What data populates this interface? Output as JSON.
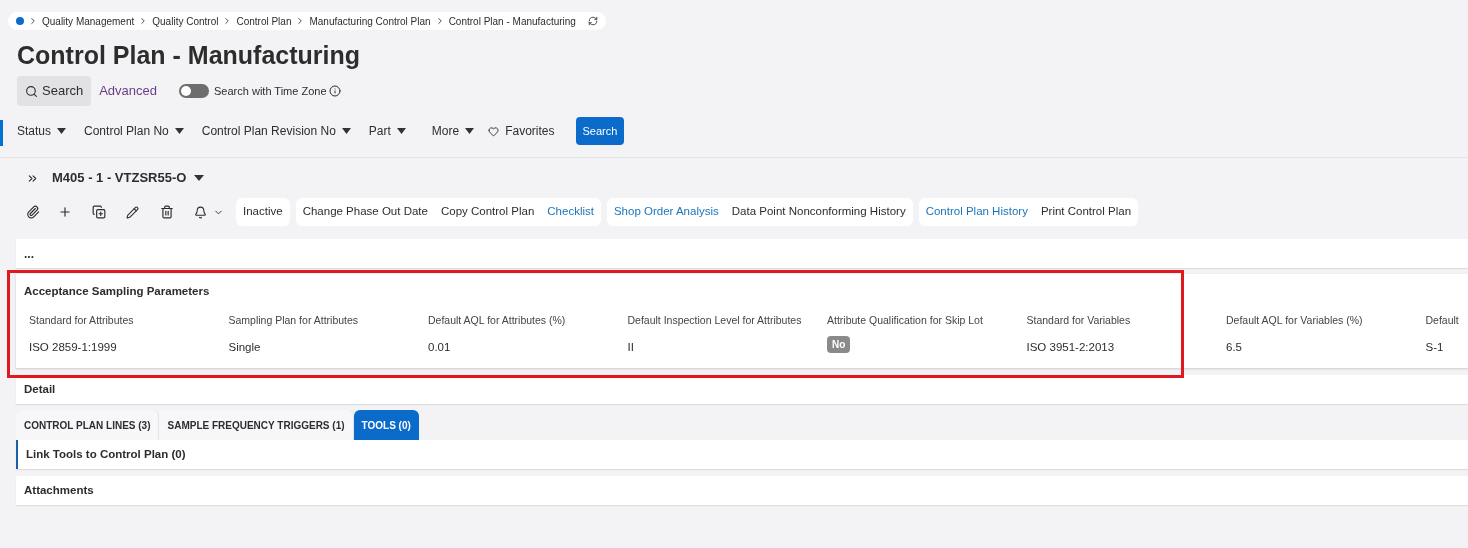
{
  "breadcrumb": [
    "Quality Management",
    "Quality Control",
    "Control Plan",
    "Manufacturing Control Plan",
    "Control Plan - Manufacturing"
  ],
  "title": "Control Plan - Manufacturing",
  "search_bar": {
    "search_tab": "Search",
    "advanced_tab": "Advanced",
    "time_zone_toggle": {
      "label": "Search with Time Zone",
      "on": false
    }
  },
  "filters": [
    "Status",
    "Control Plan No",
    "Control Plan Revision No",
    "Part",
    "More"
  ],
  "favorites": "Favorites",
  "search_button": "Search",
  "record": {
    "title": "M405 - 1 - VTZSR55-O"
  },
  "action_groups": [
    [
      {
        "label": "Inactive",
        "kind": "command"
      }
    ],
    [
      {
        "label": "Change Phase Out Date",
        "kind": "command"
      },
      {
        "label": "Copy Control Plan",
        "kind": "command"
      },
      {
        "label": "Checklist",
        "kind": "link"
      }
    ],
    [
      {
        "label": "Shop Order Analysis",
        "kind": "link"
      },
      {
        "label": "Data Point Nonconforming History",
        "kind": "command"
      }
    ],
    [
      {
        "label": "Control Plan History",
        "kind": "link"
      },
      {
        "label": "Print Control Plan",
        "kind": "command"
      }
    ]
  ],
  "collapsed_panel": "...",
  "sampling_section": {
    "title": "Acceptance Sampling Parameters",
    "highlighted": true,
    "fields": [
      {
        "label": "Standard for Attributes",
        "value": "ISO 2859-1:1999",
        "kind": "text"
      },
      {
        "label": "Sampling Plan for Attributes",
        "value": "Single",
        "kind": "text"
      },
      {
        "label": "Default AQL for Attributes (%)",
        "value": "0.01",
        "kind": "text"
      },
      {
        "label": "Default Inspection Level for Attributes",
        "value": "II",
        "kind": "text"
      },
      {
        "label": "Attribute Qualification for Skip Lot",
        "value": "No",
        "kind": "badge"
      },
      {
        "label": "Standard for Variables",
        "value": "ISO 3951-2:2013",
        "kind": "text"
      },
      {
        "label": "Default AQL for Variables (%)",
        "value": "6.5",
        "kind": "text"
      },
      {
        "label": "Default",
        "value": "S-1",
        "kind": "text"
      }
    ]
  },
  "detail_section": {
    "title": "Detail"
  },
  "tabs": [
    {
      "label": "CONTROL PLAN LINES (3)",
      "selected": false
    },
    {
      "label": "SAMPLE FREQUENCY TRIGGERS (1)",
      "selected": false
    },
    {
      "label": "TOOLS (0)",
      "selected": true
    }
  ],
  "tools_panel": {
    "title": "Link Tools to Control Plan (0)"
  },
  "attachments": {
    "title": "Attachments"
  }
}
